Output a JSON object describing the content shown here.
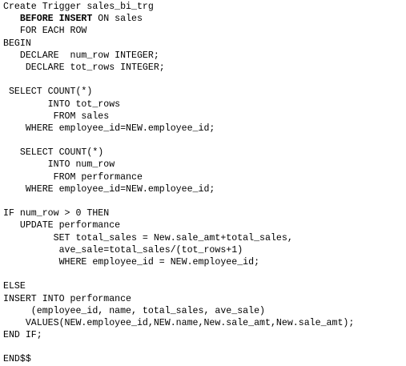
{
  "document": {
    "lines": [
      "Create Trigger sales_bi_trg",
      {
        "segments": [
          {
            "text": "   "
          },
          {
            "text": "BEFORE INSERT",
            "bold": true
          },
          {
            "text": " ON sales"
          }
        ]
      },
      "   FOR EACH ROW",
      "BEGIN",
      "   DECLARE  num_row INTEGER;",
      "    DECLARE tot_rows INTEGER;",
      "",
      " SELECT COUNT(*)",
      "        INTO tot_rows",
      "         FROM sales",
      "    WHERE employee_id=NEW.employee_id;",
      "",
      "   SELECT COUNT(*)",
      "        INTO num_row",
      "         FROM performance",
      "    WHERE employee_id=NEW.employee_id;",
      "",
      "IF num_row > 0 THEN",
      "   UPDATE performance",
      "         SET total_sales = New.sale_amt+total_sales,",
      "          ave_sale=total_sales/(tot_rows+1)",
      "          WHERE employee_id = NEW.employee_id;",
      "",
      "ELSE",
      "INSERT INTO performance",
      "     (employee_id, name, total_sales, ave_sale)",
      "    VALUES(NEW.employee_id,NEW.name,New.sale_amt,New.sale_amt);",
      "END IF;",
      "",
      "END$$"
    ]
  }
}
